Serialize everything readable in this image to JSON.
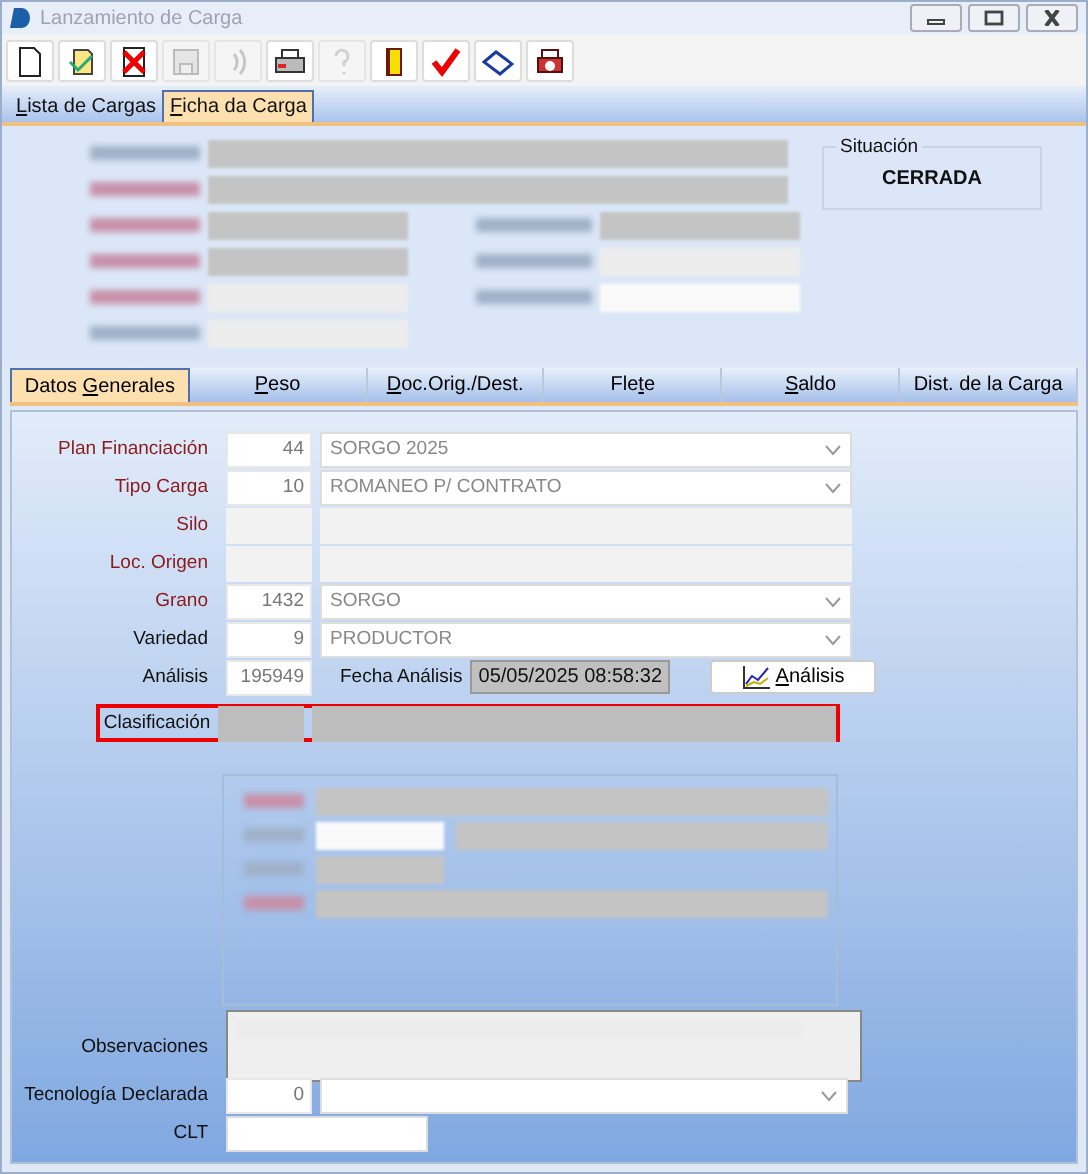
{
  "window": {
    "title": "Lanzamiento de Carga"
  },
  "toolbar": [
    {
      "disabled": false
    },
    {
      "disabled": false
    },
    {
      "disabled": false
    },
    {
      "disabled": true
    },
    {
      "disabled": true
    },
    {
      "disabled": false
    },
    {
      "disabled": true
    },
    {
      "disabled": false
    },
    {
      "disabled": false
    },
    {
      "disabled": false
    },
    {
      "disabled": false
    }
  ],
  "tabs": [
    {
      "label": "Lista de Cargas",
      "selected": false
    },
    {
      "label": "Ficha da Carga",
      "selected": true
    }
  ],
  "situacion": {
    "label": "Situación",
    "value": "CERRADA"
  },
  "subtabs": [
    {
      "label": "Datos Generales",
      "selected": true
    },
    {
      "label": "Peso",
      "selected": false
    },
    {
      "label": "Doc.Orig./Dest.",
      "selected": false
    },
    {
      "label": "Flete",
      "selected": false
    },
    {
      "label": "Saldo",
      "selected": false
    },
    {
      "label": "Dist. de la Carga",
      "selected": false
    }
  ],
  "fields": [
    {
      "kind": "combo",
      "label": "Plan Financiación",
      "required": true,
      "code": "44",
      "value": "SORGO 2025",
      "disabled": true
    },
    {
      "kind": "combo",
      "label": "Tipo Carga",
      "required": true,
      "code": "10",
      "value": "ROMANEO P/ CONTRATO",
      "disabled": true
    },
    {
      "kind": "redacted",
      "label": "Silo",
      "required": true
    },
    {
      "kind": "redacted",
      "label": "Loc. Origen",
      "required": true
    },
    {
      "kind": "combo",
      "label": "Grano",
      "required": true,
      "code": "1432",
      "value": "SORGO",
      "disabled": true
    },
    {
      "kind": "combo",
      "label": "Variedad",
      "required": false,
      "code": "9",
      "value": "PRODUCTOR",
      "disabled": true
    }
  ],
  "analisis": {
    "label": "Análisis",
    "value": "195949",
    "date_label": "Fecha Análisis",
    "date": "05/05/2025 08:58:32",
    "button": "Análisis"
  },
  "clasificacion": {
    "label": "Clasificación",
    "highlighted": true
  },
  "observaciones": {
    "label": "Observaciones"
  },
  "tecnologia": {
    "label": "Tecnología Declarada",
    "code": "0"
  },
  "clt": {
    "label": "CLT"
  }
}
